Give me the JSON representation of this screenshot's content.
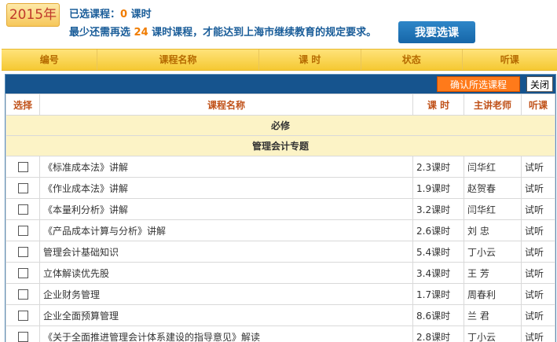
{
  "header": {
    "year": "2015年",
    "selected_prefix": "已选课程：",
    "selected_count": "0",
    "selected_suffix": " 课时",
    "req_prefix": "最少还需再选 ",
    "req_count": "24",
    "req_suffix": " 课时课程，才能达到上海市继续教育的规定要求。",
    "select_button": "我要选课"
  },
  "main_table_headers": [
    "编号",
    "课程名称",
    "课 时",
    "状态",
    "听课"
  ],
  "panel": {
    "confirm_button": "确认所选课程",
    "close_button": "关闭",
    "columns": [
      "选择",
      "课程名称",
      "课 时",
      "主讲老师",
      "听课"
    ],
    "group_required": "必修",
    "group_topic": "管理会计专题",
    "rows": [
      {
        "name": "《标准成本法》讲解",
        "hours": "2.3课时",
        "teacher": "闫华红",
        "listen": "试听"
      },
      {
        "name": "《作业成本法》讲解",
        "hours": "1.9课时",
        "teacher": "赵贺春",
        "listen": "试听"
      },
      {
        "name": "《本量利分析》讲解",
        "hours": "3.2课时",
        "teacher": "闫华红",
        "listen": "试听"
      },
      {
        "name": "《产品成本计算与分析》讲解",
        "hours": "2.6课时",
        "teacher": "刘 忠",
        "listen": "试听"
      },
      {
        "name": "管理会计基础知识",
        "hours": "5.4课时",
        "teacher": "丁小云",
        "listen": "试听"
      },
      {
        "name": "立体解读优先股",
        "hours": "3.4课时",
        "teacher": "王 芳",
        "listen": "试听"
      },
      {
        "name": "企业财务管理",
        "hours": "1.7课时",
        "teacher": "周春利",
        "listen": "试听"
      },
      {
        "name": "企业全面预算管理",
        "hours": "8.6课时",
        "teacher": "兰 君",
        "listen": "试听"
      },
      {
        "name": "《关于全面推进管理会计体系建设的指导意见》解读",
        "hours": "2.8课时",
        "teacher": "丁小云",
        "listen": "试听"
      }
    ]
  }
}
